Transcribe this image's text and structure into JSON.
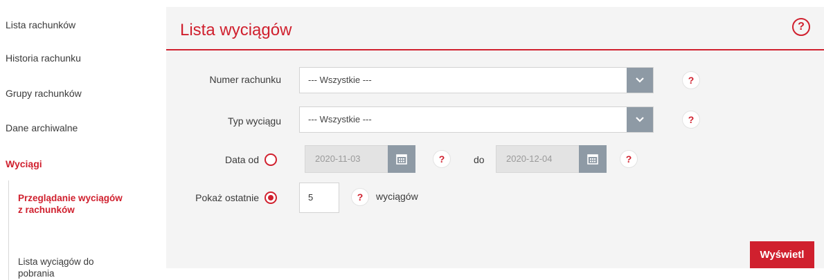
{
  "sidebar": {
    "items": [
      {
        "label": "Lista rachunków"
      },
      {
        "label": "Historia rachunku"
      },
      {
        "label": "Grupy rachunków"
      },
      {
        "label": "Dane archiwalne"
      },
      {
        "label": "Wyciągi"
      }
    ],
    "subitems": [
      {
        "label": "Przeglądanie wyciągów z rachunków"
      },
      {
        "label": "Lista wyciągów do pobrania"
      }
    ]
  },
  "main": {
    "title": "Lista wyciągów",
    "help_symbol": "?",
    "form": {
      "account_label": "Numer rachunku",
      "account_value": "--- Wszystkie ---",
      "type_label": "Typ wyciągu",
      "type_value": "--- Wszystkie ---",
      "date_from_label": "Data od",
      "date_from_value": "2020-11-03",
      "date_to_label": "do",
      "date_to_value": "2020-12-04",
      "show_last_label": "Pokaż ostatnie",
      "show_last_value": "5",
      "show_last_unit": "wyciągów",
      "selected_option": "show_last"
    },
    "submit_label": "Wyświetl"
  },
  "colors": {
    "accent": "#d0202e",
    "panel_bg": "#f4f4f4",
    "control_gray": "#8e9aa5"
  }
}
